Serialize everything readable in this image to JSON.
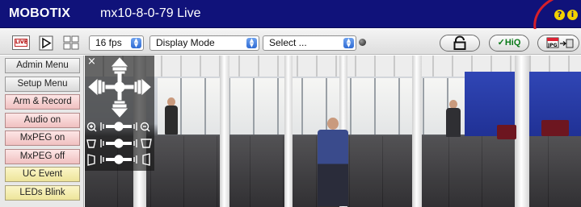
{
  "header": {
    "brand": "MOBOTIX",
    "title": "mx10-8-0-79 Live",
    "help_icon": "?",
    "info_icon": "i",
    "bg_color": "#10127a",
    "highlight_color": "#d71f2a"
  },
  "toolbar": {
    "live_label": "LIVE",
    "fps": "16 fps",
    "display_mode": "Display Mode",
    "select": "Select ...",
    "hiq_label": "✓HiQ",
    "jpg_label": "JPG"
  },
  "menu": {
    "items": [
      {
        "label": "Admin Menu",
        "style": "grey"
      },
      {
        "label": "Setup Menu",
        "style": "grey"
      },
      {
        "label": "Arm & Record",
        "style": "pink"
      },
      {
        "label": "Audio on",
        "style": "pink"
      },
      {
        "label": "MxPEG on",
        "style": "pink"
      },
      {
        "label": "MxPEG off",
        "style": "pink"
      },
      {
        "label": "UC Event",
        "style": "yellow"
      },
      {
        "label": "LEDs Blink",
        "style": "yellow"
      }
    ]
  },
  "ptz": {
    "close": "×",
    "icons": [
      "pan-tilt-pad",
      "zoom-slider",
      "pan-slider",
      "tilt-slider"
    ]
  }
}
